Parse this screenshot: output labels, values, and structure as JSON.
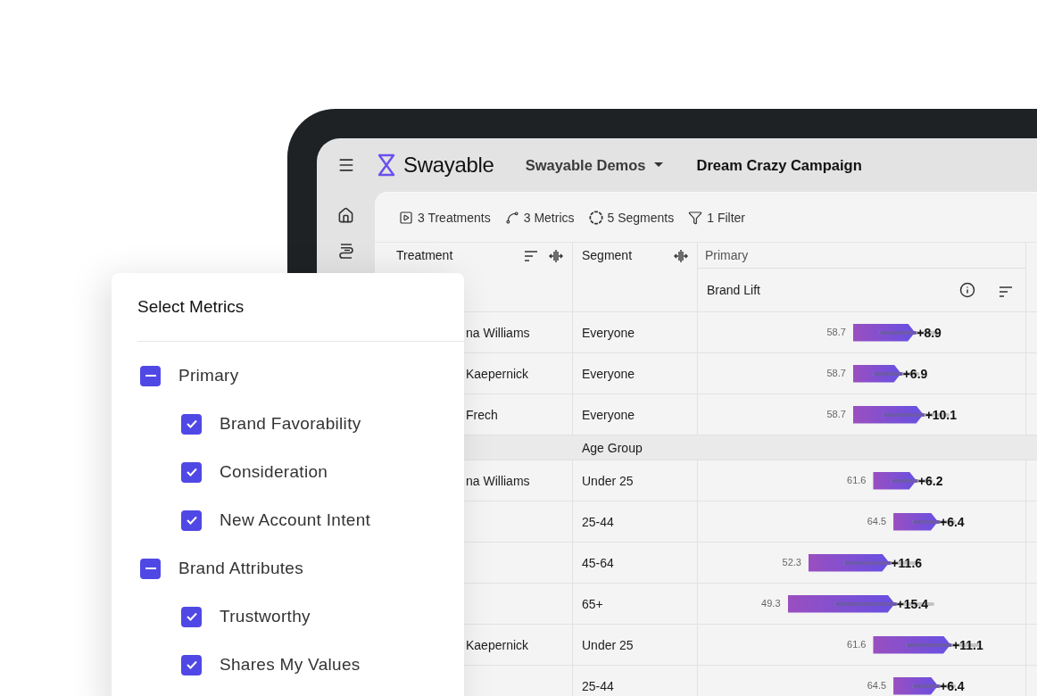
{
  "header": {
    "brand": "Swayable",
    "workspace": "Swayable Demos",
    "campaign": "Dream Crazy Campaign"
  },
  "toolbar": [
    {
      "kind": "treatments",
      "label": "3 Treatments"
    },
    {
      "kind": "metrics",
      "label": "3 Metrics"
    },
    {
      "kind": "segments",
      "label": "5 Segments"
    },
    {
      "kind": "filter",
      "label": "1 Filter"
    }
  ],
  "table": {
    "columns": [
      {
        "label": "Treatment",
        "sortable": true
      },
      {
        "label": "Segment",
        "sortable": false
      }
    ],
    "group_header": "Primary",
    "metric": "Brand Lift",
    "rows": [
      {
        "kind": "data",
        "treatment": "na Williams",
        "segment": "Everyone",
        "baseline": "58.7",
        "lift": "+8.9"
      },
      {
        "kind": "data",
        "treatment": "Kaepernick",
        "segment": "Everyone",
        "baseline": "58.7",
        "lift": "+6.9"
      },
      {
        "kind": "data",
        "treatment": "Frech",
        "segment": "Everyone",
        "baseline": "58.7",
        "lift": "+10.1"
      },
      {
        "kind": "group",
        "segment": "Age Group"
      },
      {
        "kind": "data",
        "treatment": "na Williams",
        "segment": "Under 25",
        "baseline": "61.6",
        "lift": "+6.2"
      },
      {
        "kind": "data",
        "segment": "25-44",
        "baseline": "64.5",
        "lift": "+6.4"
      },
      {
        "kind": "data",
        "segment": "45-64",
        "baseline": "52.3",
        "lift": "+11.6"
      },
      {
        "kind": "data",
        "segment": "65+",
        "baseline": "49.3",
        "lift": "+15.4"
      },
      {
        "kind": "data",
        "treatment": "Kaepernick",
        "segment": "Under 25",
        "baseline": "61.6",
        "lift": "+11.1"
      },
      {
        "kind": "data",
        "segment": "25-44",
        "baseline": "64.5",
        "lift": "+6.4"
      }
    ]
  },
  "metric_picker": {
    "title": "Select Metrics",
    "groups": [
      {
        "label": "Primary",
        "indeterminate": true,
        "children": [
          {
            "label": "Brand Favorability",
            "checked": true
          },
          {
            "label": "Consideration",
            "checked": true
          },
          {
            "label": "New Account Intent",
            "checked": true
          }
        ]
      },
      {
        "label": "Brand Attributes",
        "indeterminate": true,
        "children": [
          {
            "label": "Trustworthy",
            "checked": true
          },
          {
            "label": "Shares My Values",
            "checked": true
          }
        ]
      }
    ]
  }
}
